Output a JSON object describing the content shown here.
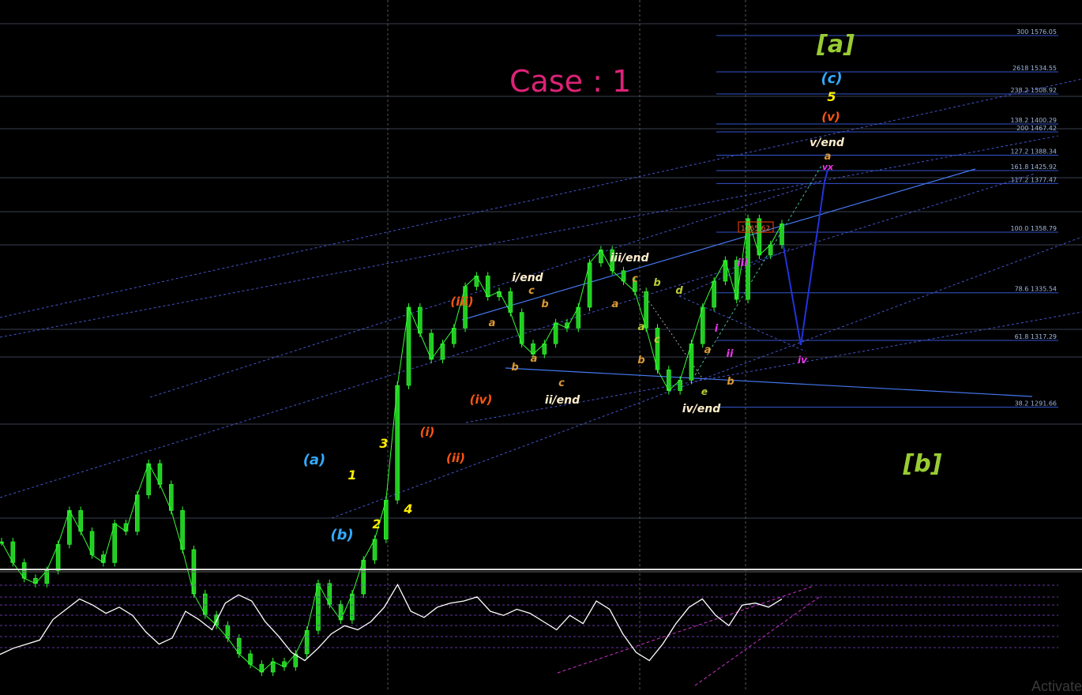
{
  "colors": {
    "background": "#000000",
    "candle": "#33ff33",
    "hline": "#3a3f52",
    "fib": "#3355cc",
    "channel_dash": "#4455cc",
    "channel_solid": "#4477ee",
    "projection": "#2233dd",
    "oscillator": "#ffffff",
    "osc_div": "#cc33cc",
    "title": "#dd2277",
    "grid_v": "#555555"
  },
  "title": "Case : 1",
  "price_label": "1365.62",
  "watermark": "Activate",
  "chart_data": {
    "type": "line",
    "series": [
      {
        "values": [
          1240,
          1232,
          1226,
          1224,
          1229,
          1239,
          1252,
          1244,
          1235,
          1232,
          1247,
          1244,
          1258,
          1270,
          1262,
          1252,
          1237,
          1220,
          1212,
          1208,
          1203,
          1197,
          1193,
          1190,
          1194,
          1192,
          1197,
          1206,
          1224,
          1216,
          1210,
          1220,
          1233,
          1241,
          1256,
          1300,
          1330,
          1320,
          1310,
          1316,
          1322,
          1338,
          1342,
          1334,
          1336,
          1328,
          1316,
          1312,
          1316,
          1324,
          1322,
          1330,
          1347,
          1352,
          1344,
          1340,
          1336,
          1322,
          1306,
          1298,
          1302,
          1316,
          1330,
          1340,
          1348,
          1333,
          1364,
          1350,
          1354,
          1362
        ]
      }
    ],
    "fib_levels": [
      {
        "label": "300 1576.05"
      },
      {
        "label": "2618 1534.55"
      },
      {
        "label": "238.2 1508.92"
      },
      {
        "label": "200 1467.42"
      },
      {
        "label": "161.8 1425.92"
      },
      {
        "label": "138.2 1400.29"
      },
      {
        "label": "127.2 1388.34"
      },
      {
        "label": "117.2 1377.47"
      },
      {
        "label": "100.0   1358.79"
      },
      {
        "label": "78.6 1335.54"
      },
      {
        "label": "61.8 1317.29"
      },
      {
        "label": "38.2 1291.66"
      }
    ],
    "wave_labels": [
      {
        "text": "[a]",
        "color": "#99cc33"
      },
      {
        "text": "[b]",
        "color": "#99cc33"
      },
      {
        "text": "(c)",
        "color": "#33aaff"
      },
      {
        "text": "5",
        "color": "#ffee00"
      },
      {
        "text": "(v)",
        "color": "#ff5511"
      },
      {
        "text": "v/end",
        "color": "#ffeecc"
      },
      {
        "text": "a",
        "color": "#dd9933"
      },
      {
        "text": "vx",
        "color": "#ee33ee"
      },
      {
        "text": "iii/end",
        "color": "#ffeecc"
      },
      {
        "text": "i/end",
        "color": "#ffeecc"
      },
      {
        "text": "(iii)",
        "color": "#ff5511"
      },
      {
        "text": "iii",
        "color": "#ee33ee"
      },
      {
        "text": "c",
        "color": "#dd9933"
      },
      {
        "text": "b",
        "color": "#bbcc33"
      },
      {
        "text": "d",
        "color": "#bbcc33"
      },
      {
        "text": "a",
        "color": "#dd9933"
      },
      {
        "text": "c",
        "color": "#dd9933"
      },
      {
        "text": "b",
        "color": "#dd9933"
      },
      {
        "text": "a",
        "color": "#dd9933"
      },
      {
        "text": "b",
        "color": "#dd9933"
      },
      {
        "text": "a",
        "color": "#dd9933"
      },
      {
        "text": "c",
        "color": "#dd9933"
      },
      {
        "text": "a",
        "color": "#bbcc33"
      },
      {
        "text": "c",
        "color": "#bbcc33"
      },
      {
        "text": "b",
        "color": "#dd9933"
      },
      {
        "text": "i",
        "color": "#ee33ee"
      },
      {
        "text": "ii",
        "color": "#ee33ee"
      },
      {
        "text": "a",
        "color": "#dd9933"
      },
      {
        "text": "b",
        "color": "#dd9933"
      },
      {
        "text": "e",
        "color": "#bbcc33"
      },
      {
        "text": "iv/end",
        "color": "#ffeecc"
      },
      {
        "text": "iv",
        "color": "#ee33ee"
      },
      {
        "text": "(iv)",
        "color": "#ff5511"
      },
      {
        "text": "ii/end",
        "color": "#ffeecc"
      },
      {
        "text": "(i)",
        "color": "#ff5511"
      },
      {
        "text": "(ii)",
        "color": "#ff5511"
      },
      {
        "text": "3",
        "color": "#ffee00"
      },
      {
        "text": "1",
        "color": "#ffee00"
      },
      {
        "text": "2",
        "color": "#ffee00"
      },
      {
        "text": "4",
        "color": "#ffee00"
      },
      {
        "text": "(a)",
        "color": "#33aaff"
      },
      {
        "text": "(b)",
        "color": "#33aaff"
      }
    ],
    "oscillator": {
      "values": [
        28,
        34,
        38,
        42,
        62,
        72,
        82,
        76,
        68,
        74,
        66,
        50,
        38,
        44,
        70,
        62,
        52,
        78,
        86,
        80,
        60,
        46,
        30,
        22,
        34,
        48,
        56,
        52,
        60,
        74,
        96,
        70,
        64,
        74,
        78,
        80,
        84,
        70,
        66,
        72,
        68,
        60,
        52,
        66,
        58,
        80,
        72,
        48,
        30,
        22,
        38,
        58,
        74,
        82,
        66,
        56,
        76,
        78,
        74,
        82
      ]
    }
  }
}
